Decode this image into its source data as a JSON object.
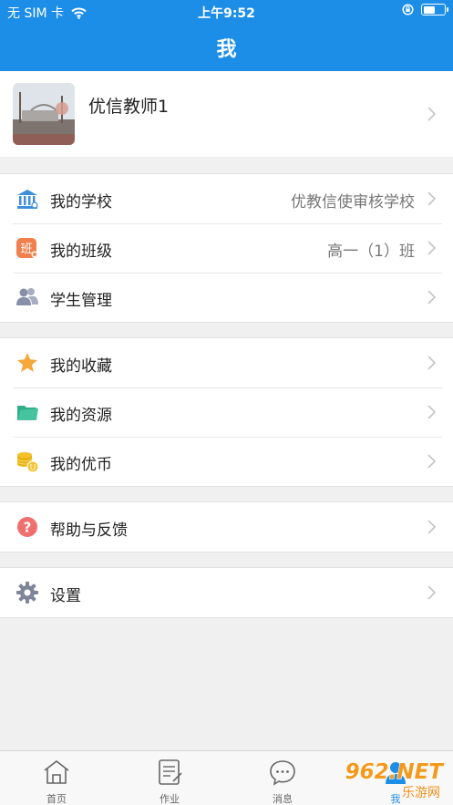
{
  "status": {
    "carrier": "无 SIM 卡",
    "time": "上午9:52"
  },
  "nav": {
    "title": "我"
  },
  "profile": {
    "name": "优信教师1"
  },
  "groups": [
    [
      {
        "label": "我的学校",
        "value": "优教信使审核学校",
        "icon": "bank-icon"
      },
      {
        "label": "我的班级",
        "value": "高一（1）班",
        "icon": "class-badge-icon",
        "icon_text": "班"
      },
      {
        "label": "学生管理",
        "value": "",
        "icon": "people-icon"
      }
    ],
    [
      {
        "label": "我的收藏",
        "value": "",
        "icon": "star-icon"
      },
      {
        "label": "我的资源",
        "value": "",
        "icon": "folder-icon"
      },
      {
        "label": "我的优币",
        "value": "",
        "icon": "coins-icon"
      }
    ],
    [
      {
        "label": "帮助与反馈",
        "value": "",
        "icon": "help-icon",
        "icon_text": "?"
      }
    ],
    [
      {
        "label": "设置",
        "value": "",
        "icon": "gear-icon"
      }
    ]
  ],
  "tabs": [
    {
      "label": "首页",
      "icon": "home-icon",
      "active": false
    },
    {
      "label": "作业",
      "icon": "homework-icon",
      "active": false
    },
    {
      "label": "消息",
      "icon": "message-icon",
      "active": false
    },
    {
      "label": "我",
      "icon": "me-icon",
      "active": true
    }
  ],
  "watermark": {
    "text": "962.NET",
    "sub": "乐游网"
  },
  "colors": {
    "accent": "#1c8ee8",
    "background": "#f0f0f0"
  }
}
